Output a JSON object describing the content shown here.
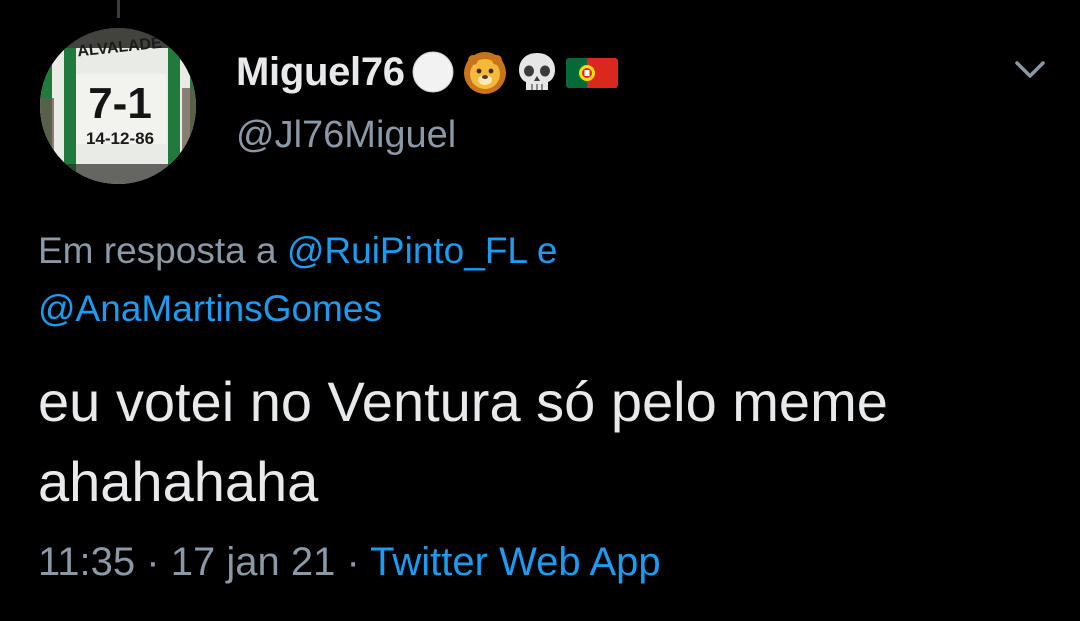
{
  "tweet": {
    "author": {
      "display_name": "Miguel76",
      "name_emojis": [
        "white-circle",
        "lion",
        "skull",
        "portugal-flag"
      ],
      "handle": "@Jl76Miguel",
      "avatar": {
        "description": "green and white striped jersey",
        "jersey_top_text": "ALVALADE",
        "jersey_number": "7-1",
        "jersey_date": "14-12-86"
      }
    },
    "reply_context": {
      "prefix": "Em resposta a",
      "mention_1": "@RuiPinto_FL",
      "joiner": "e",
      "mention_2": "@AnaMartinsGomes"
    },
    "text_line_1": "eu votei no Ventura só pelo meme",
    "text_line_2": "ahahahaha",
    "meta": {
      "time": "11:35",
      "separator": "·",
      "date": "17 jan 21",
      "source": "Twitter Web App"
    }
  },
  "colors": {
    "background": "#000000",
    "primary_text": "#e7e9ea",
    "secondary_text": "#8b98a5",
    "link": "#1d9bf0"
  },
  "icons": {
    "menu": "chevron-down-icon"
  }
}
